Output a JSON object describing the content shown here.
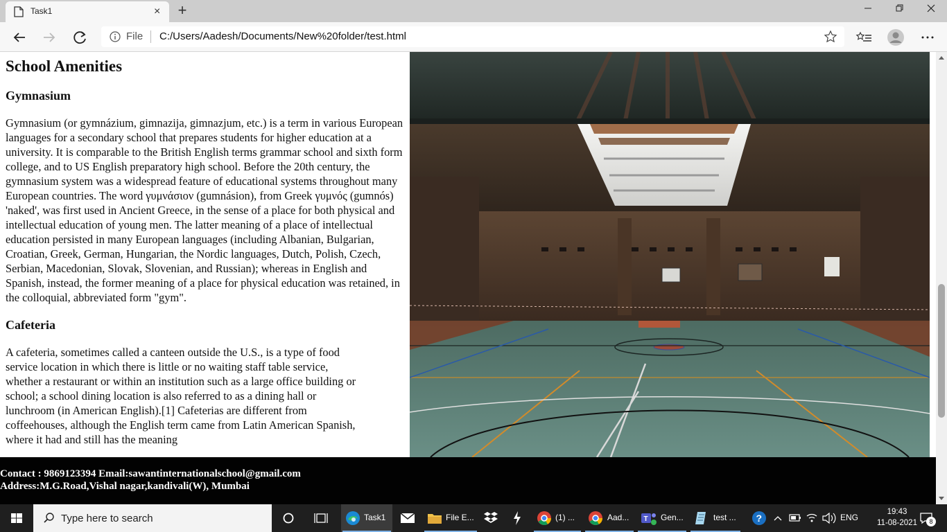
{
  "browser": {
    "tab_title": "Task1",
    "close_tab": "×",
    "new_tab": "+",
    "window_controls": {
      "minimize": "—",
      "restore": "❐",
      "close": "✕"
    },
    "address": {
      "scheme_label": "File",
      "url": "C:/Users/Aadesh/Documents/New%20folder/test.html"
    }
  },
  "page": {
    "heading": "School Amenities",
    "sections": [
      {
        "title": "Gymnasium",
        "body": "Gymnasium (or gymnázium, gimnazija, gimnazjum, etc.) is a term in various European languages for a secondary school that prepares students for higher education at a university. It is comparable to the British English terms grammar school and sixth form college, and to US English preparatory high school. Before the 20th century, the gymnasium system was a widespread feature of educational systems throughout many European countries. The word γυμνάσιον (gumnásion), from Greek γυμνός (gumnós) 'naked', was first used in Ancient Greece, in the sense of a place for both physical and intellectual education of young men. The latter meaning of a place of intellectual education persisted in many European languages (including Albanian, Bulgarian, Croatian, Greek, German, Hungarian, the Nordic languages, Dutch, Polish, Czech, Serbian, Macedonian, Slovak, Slovenian, and Russian); whereas in English and Spanish, instead, the former meaning of a place for physical education was retained, in the colloquial, abbreviated form \"gym\"."
      },
      {
        "title": "Cafeteria",
        "body": "A cafeteria, sometimes called a canteen outside the U.S., is a type of food service location in which there is little or no waiting staff table service, whether a restaurant or within an institution such as a large office building or school; a school dining location is also referred to as a dining hall or lunchroom (in American English).[1] Cafeterias are different from coffeehouses, although the English term came from Latin American Spanish, where it had and still has the meaning"
      }
    ],
    "footer": {
      "contact": "Contact : 9869123394 Email:sawantinternationalschool@gmail.com",
      "address": "Address:M.G.Road,Vishal nagar,kandivali(W), Mumbai"
    }
  },
  "taskbar": {
    "search_placeholder": "Type here to search",
    "apps": [
      {
        "label": "Task1",
        "icon": "edge-icon"
      },
      {
        "label": "",
        "icon": "mail-icon"
      },
      {
        "label": "File E...",
        "icon": "folder-icon"
      },
      {
        "label": "",
        "icon": "dropbox-icon"
      },
      {
        "label": "",
        "icon": "lightning-icon"
      },
      {
        "label": "(1) ...",
        "icon": "chrome-icon"
      },
      {
        "label": "Aad...",
        "icon": "chrome-icon"
      },
      {
        "label": "Gen...",
        "icon": "teams-icon"
      },
      {
        "label": "test ...",
        "icon": "notepad-icon"
      }
    ],
    "language": "ENG",
    "time": "19:43",
    "date": "11-08-2021",
    "notification_count": "8"
  },
  "colors": {
    "taskbar": "#1f1f1f",
    "tab_strip": "#cdcdcd",
    "footer": "#020202",
    "taskbar_accent": "#7fb2e6"
  }
}
